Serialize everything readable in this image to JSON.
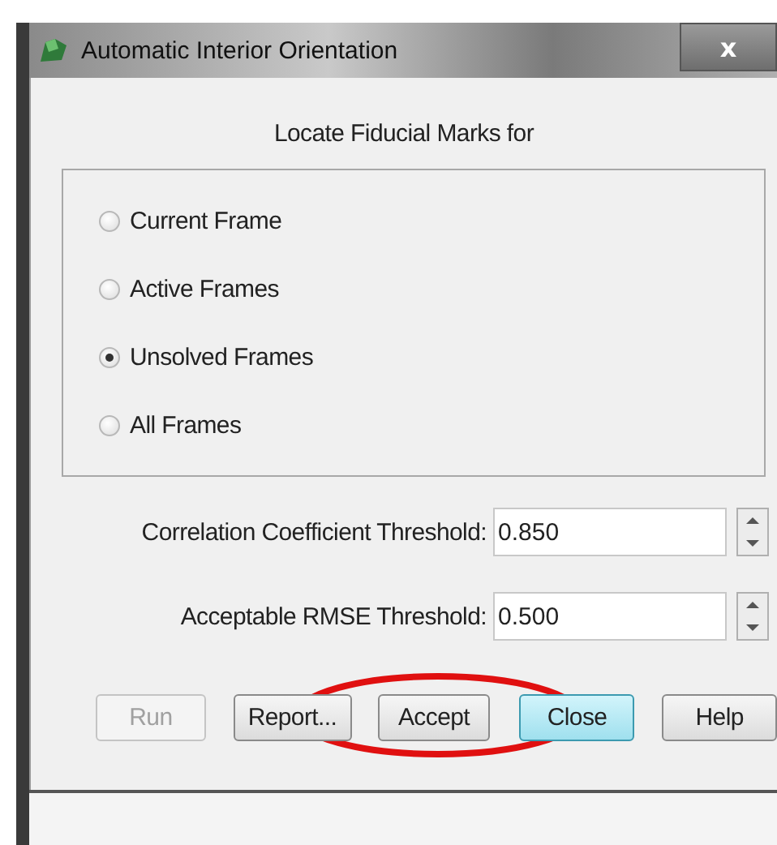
{
  "window": {
    "title": "Automatic Interior Orientation",
    "close_label": "x"
  },
  "heading": "Locate Fiducial Marks for",
  "options": [
    {
      "label": "Current Frame",
      "selected": false
    },
    {
      "label": "Active Frames",
      "selected": false
    },
    {
      "label": "Unsolved Frames",
      "selected": true
    },
    {
      "label": "All Frames",
      "selected": false
    }
  ],
  "fields": [
    {
      "label": "Correlation Coefficient Threshold:",
      "value": "0.850"
    },
    {
      "label": "Acceptable RMSE Threshold:",
      "value": "0.500"
    }
  ],
  "buttons": [
    {
      "label": "Run",
      "disabled": true,
      "default": false
    },
    {
      "label": "Report...",
      "disabled": false,
      "default": false
    },
    {
      "label": "Accept",
      "disabled": false,
      "default": false
    },
    {
      "label": "Close",
      "disabled": false,
      "default": true
    },
    {
      "label": "Help",
      "disabled": false,
      "default": false
    }
  ]
}
